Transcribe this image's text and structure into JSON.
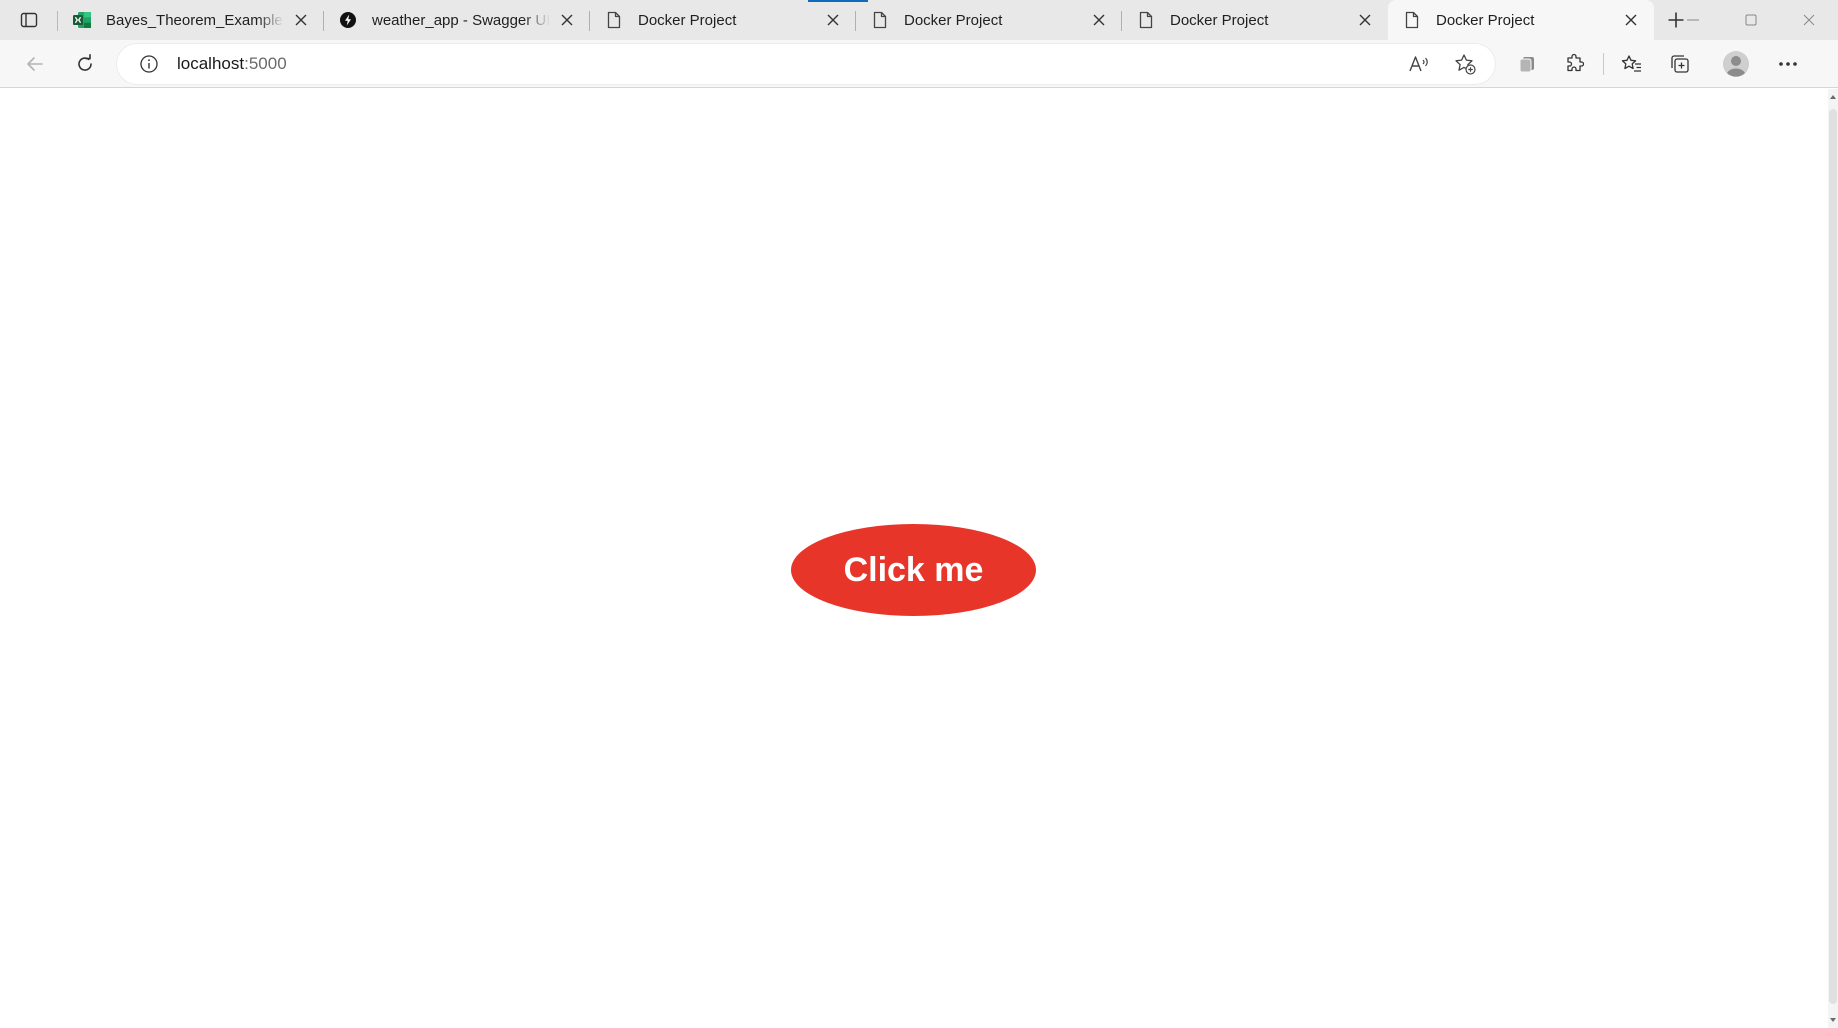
{
  "tabs": [
    {
      "title": "Bayes_Theorem_Examples.xlsx",
      "icon": "excel-icon",
      "active": false
    },
    {
      "title": "weather_app - Swagger UI",
      "icon": "swagger-icon",
      "active": false
    },
    {
      "title": "Docker Project",
      "icon": "page-icon",
      "active": false
    },
    {
      "title": "Docker Project",
      "icon": "page-icon",
      "active": false
    },
    {
      "title": "Docker Project",
      "icon": "page-icon",
      "active": false
    },
    {
      "title": "Docker Project",
      "icon": "page-icon",
      "active": true
    }
  ],
  "address": {
    "host": "localhost",
    "port": ":5000"
  },
  "page": {
    "button_label": "Click me"
  },
  "colors": {
    "button": "#e8352a",
    "excel": "#1d6f42",
    "loading": "#0f6cbd"
  }
}
